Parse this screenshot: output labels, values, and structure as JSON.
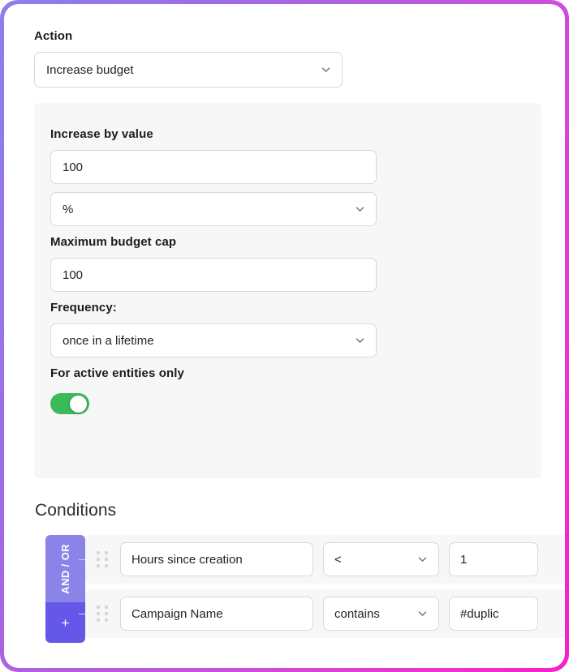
{
  "action": {
    "label": "Action",
    "selected": "Increase budget",
    "chevron_icon": "chevron-down-icon"
  },
  "settings": {
    "increase_by": {
      "label": "Increase by value",
      "value": "100",
      "unit": "%",
      "unit_chevron_icon": "chevron-down-icon"
    },
    "budget_cap": {
      "label": "Maximum budget cap",
      "value": "100"
    },
    "frequency": {
      "label": "Frequency:",
      "value": "once in a lifetime",
      "chevron_icon": "chevron-down-icon"
    },
    "active_only": {
      "label": "For active entities only",
      "toggle_state": "on",
      "toggle_color": "#3cb95b"
    }
  },
  "conditions": {
    "heading": "Conditions",
    "logic_button": {
      "label": "AND / OR",
      "color": "#8b84e8"
    },
    "add_button": {
      "label": "+",
      "color": "#6558e8"
    },
    "rows": [
      {
        "drag_icon": "drag-handle-icon",
        "attribute": "Hours since creation",
        "operator": "<",
        "operator_chevron_icon": "chevron-down-icon",
        "value": "1"
      },
      {
        "drag_icon": "drag-handle-icon",
        "attribute": "Campaign Name",
        "operator": "contains",
        "operator_chevron_icon": "chevron-down-icon",
        "value": "#duplic"
      }
    ]
  },
  "theme": {
    "border_gradient_start": "#8b80ec",
    "border_gradient_end": "#f51fc9",
    "panel_background": "#f7f7f8"
  }
}
